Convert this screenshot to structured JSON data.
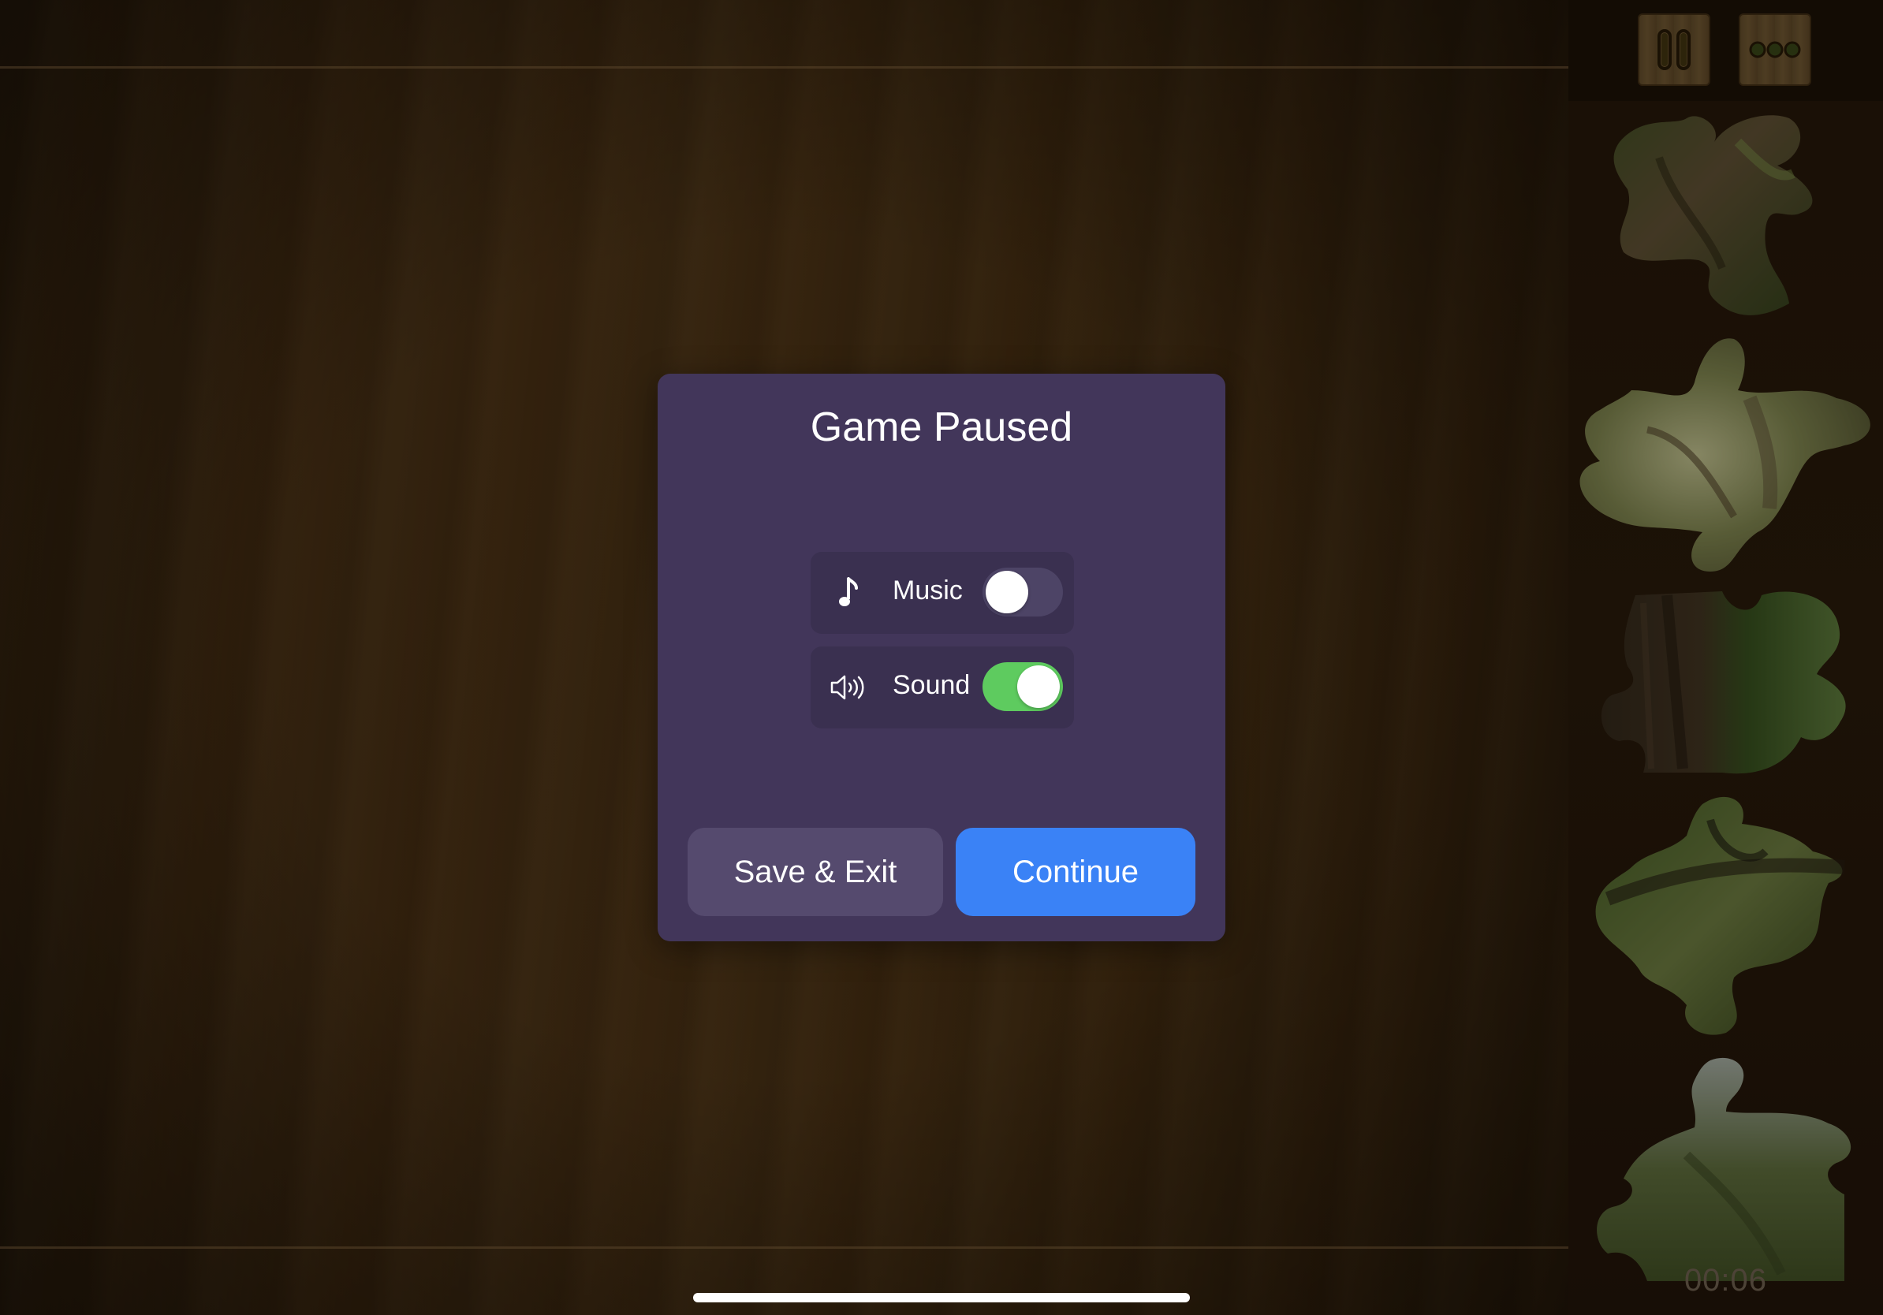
{
  "dialog": {
    "title": "Game Paused",
    "music": {
      "label": "Music",
      "icon": "music-note-icon",
      "enabled": false
    },
    "sound": {
      "label": "Sound",
      "icon": "speaker-icon",
      "enabled": true
    },
    "save_exit_label": "Save & Exit",
    "continue_label": "Continue"
  },
  "tray": {
    "buttons": [
      "pause-icon",
      "more-icon"
    ],
    "timer": "00:06"
  },
  "colors": {
    "dialog_bg": "#42365a",
    "continue_button": "#3a82f6",
    "save_button": "#554a6e",
    "toggle_on": "#5ecb5f",
    "toggle_off": "#4d4466"
  }
}
